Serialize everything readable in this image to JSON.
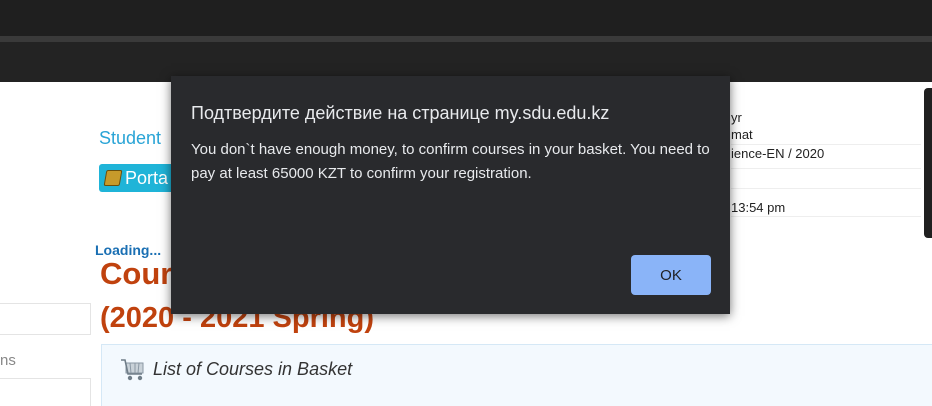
{
  "page": {
    "student_link": "Student",
    "portal_button": "Porta",
    "loading": "Loading...",
    "courses_title": "Cour",
    "courses_subtitle": "(2020 - 2021 Spring)",
    "left_fragment": "ns",
    "basket_title": "List of Courses in Basket",
    "info": {
      "line1": "yr",
      "line2": "mat",
      "line3": "ience-EN / 2020",
      "line4": "13:54 pm"
    }
  },
  "dialog": {
    "title": "Подтвердите действие на странице my.sdu.edu.kz",
    "message": "You don`t have enough money, to confirm courses in your basket. You need to pay at least 65000 KZT to confirm your registration.",
    "ok_label": "OK"
  },
  "colors": {
    "dialog_bg": "#292a2d",
    "ok_button": "#8ab4f8",
    "title_accent": "#c0420e",
    "link": "#29a4d6"
  },
  "icons": [
    "book-icon",
    "cart-icon"
  ]
}
